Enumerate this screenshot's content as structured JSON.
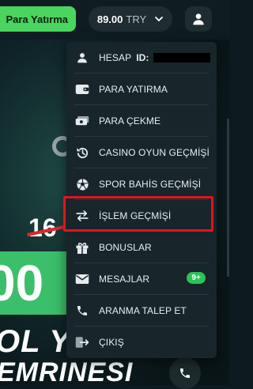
{
  "header": {
    "deposit_label": "Para Yatırma",
    "balance_amount": "89.00",
    "balance_currency": "TRY",
    "chevron": "chevron-down-icon",
    "profile": "user-icon"
  },
  "background": {
    "promo_struck": "16",
    "promo_big": "00",
    "slogan_line1": "OL YASNON",
    "slogan_line2": "EMRINESI",
    "accent_green": "#3bbf6a",
    "strike_red": "#e0262f"
  },
  "menu": {
    "account": {
      "label": "HESAP",
      "id_label": "ID:",
      "icon": "user-icon"
    },
    "items": [
      {
        "label": "PARA YATIRMA",
        "icon": "wallet-icon"
      },
      {
        "label": "PARA ÇEKME",
        "icon": "cash-icon"
      },
      {
        "label": "CASINO OYUN GEÇMİŞİ",
        "icon": "history-icon"
      },
      {
        "label": "SPOR BAHİS GEÇMİŞİ",
        "icon": "football-icon"
      },
      {
        "label": "İŞLEM GEÇMİŞİ",
        "icon": "transfer-arrows-icon"
      },
      {
        "label": "BONUSLAR",
        "icon": "gift-icon"
      },
      {
        "label": "MESAJLAR",
        "icon": "mail-icon",
        "badge": "9+"
      },
      {
        "label": "ARANMA TALEP ET",
        "icon": "phone-icon"
      },
      {
        "label": "ÇIKIŞ",
        "icon": "logout-icon"
      }
    ],
    "highlight_color": "#e0141d",
    "badge_color": "#29c456"
  }
}
